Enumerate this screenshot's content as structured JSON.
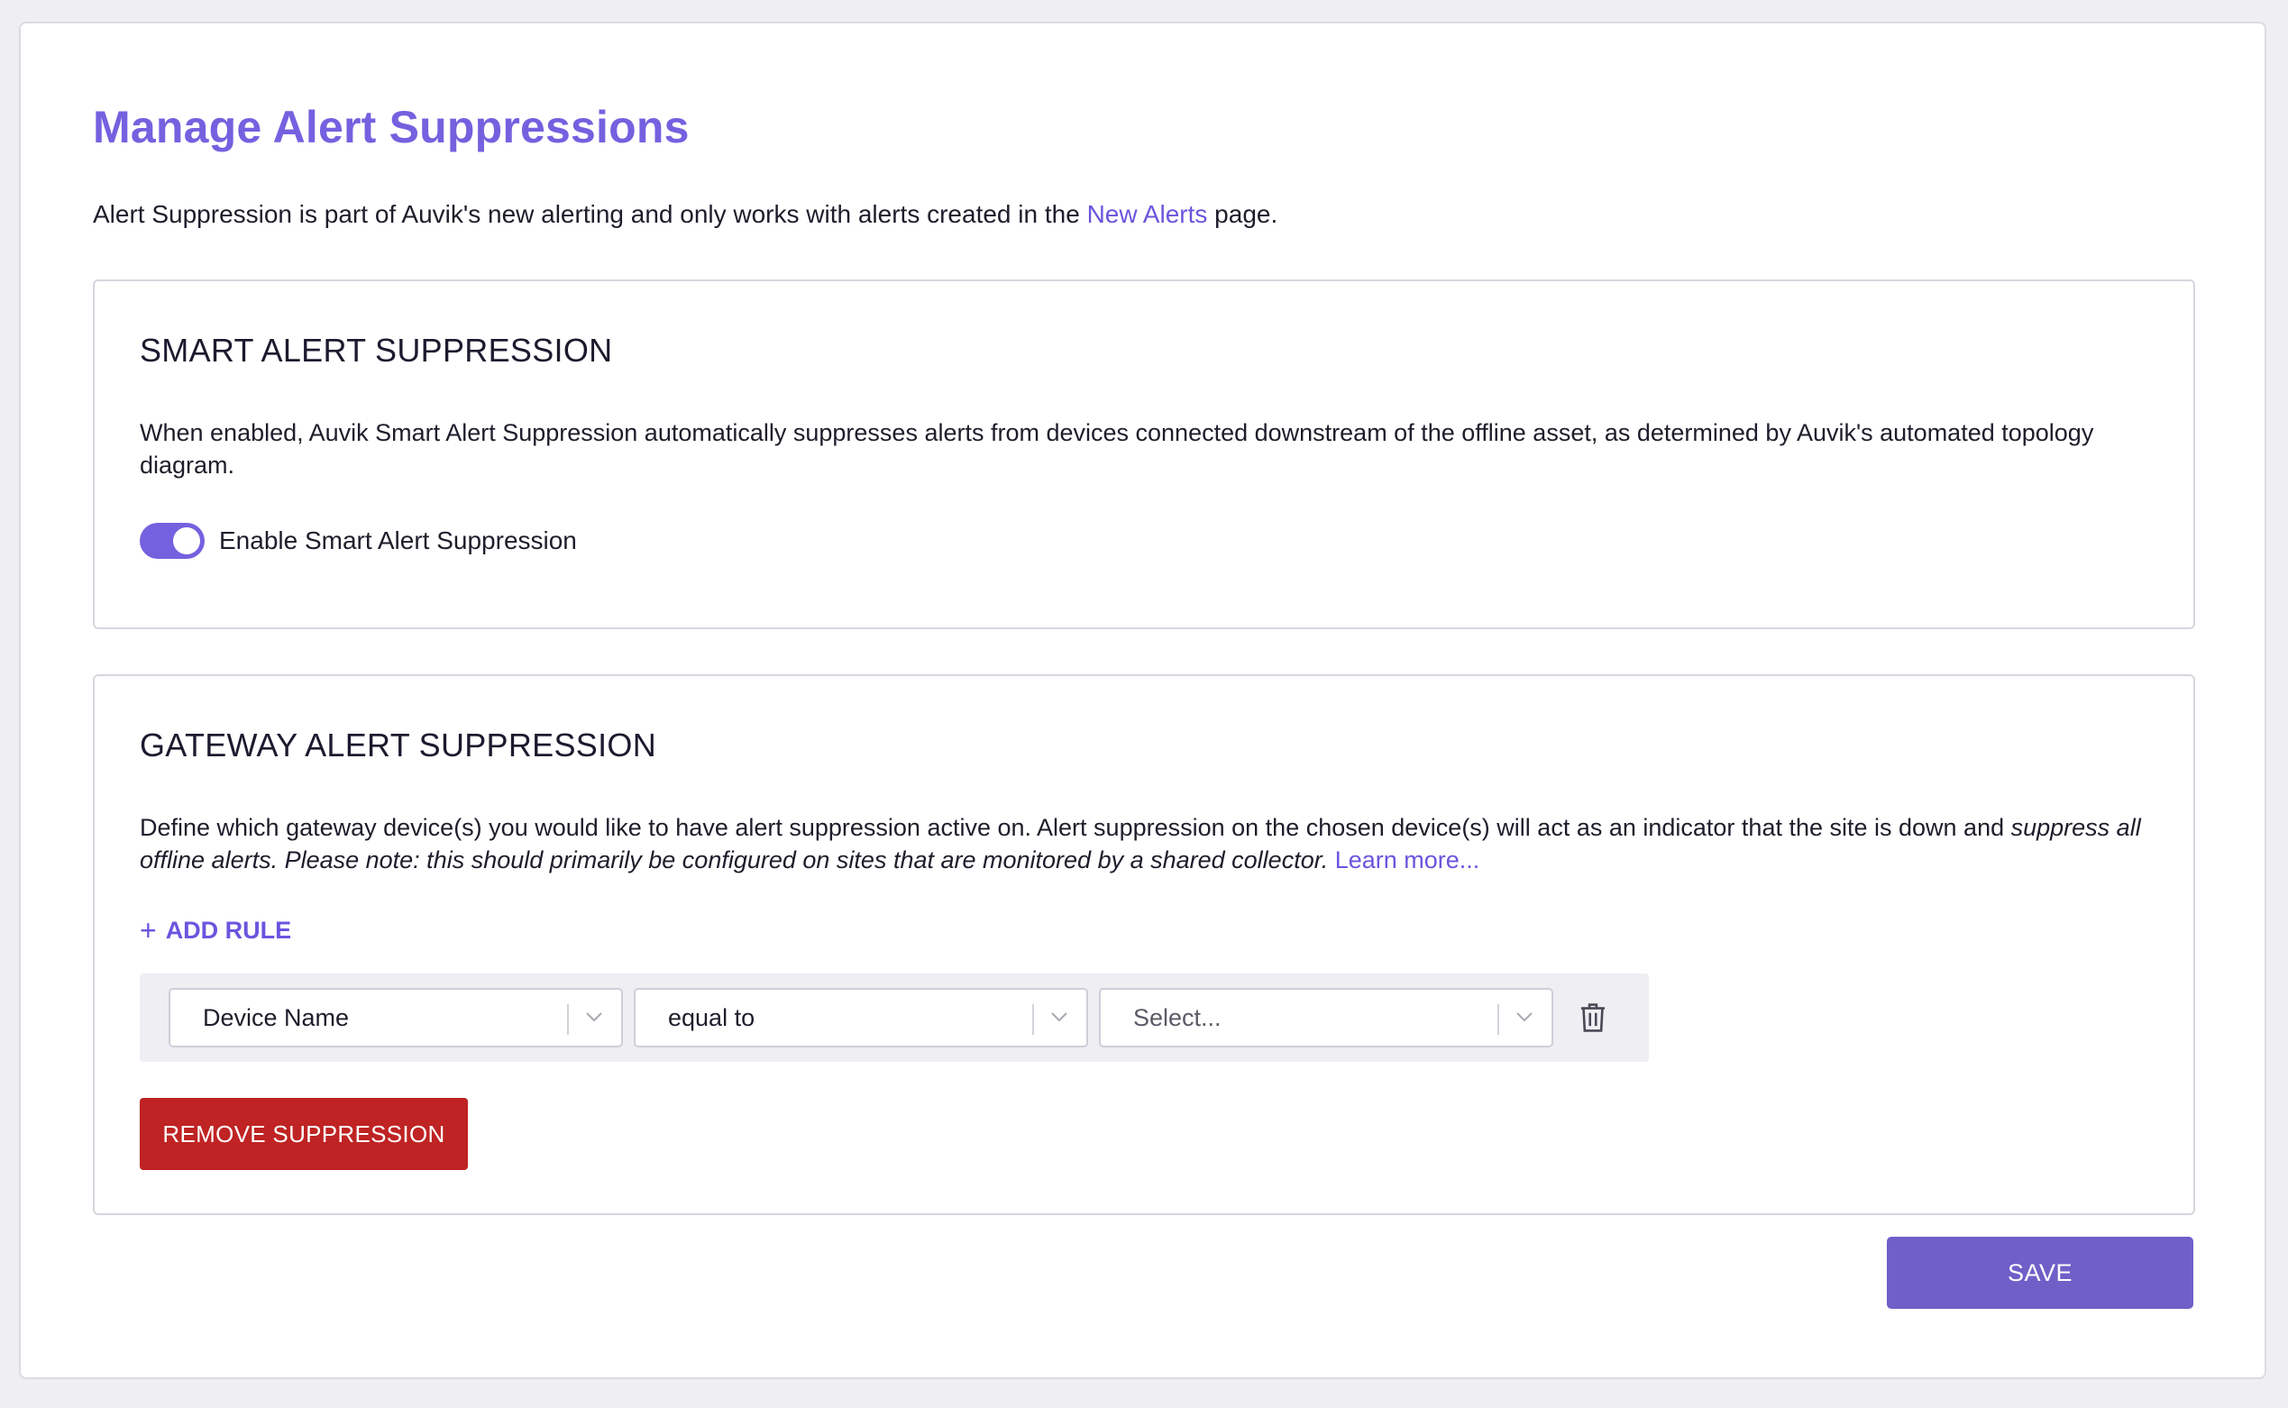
{
  "page": {
    "title": "Manage Alert Suppressions",
    "intro_before": "Alert Suppression is part of Auvik's new alerting and only works with alerts created in the ",
    "intro_link": "New Alerts",
    "intro_after": " page."
  },
  "smart": {
    "title": "SMART ALERT SUPPRESSION",
    "description": "When enabled, Auvik Smart Alert Suppression automatically suppresses alerts from devices connected downstream of the offline asset, as determined by Auvik's automated topology diagram.",
    "toggle_label": "Enable Smart Alert Suppression",
    "toggle_on": true
  },
  "gateway": {
    "title": "GATEWAY ALERT SUPPRESSION",
    "description_plain": "Define which gateway device(s) you would like to have alert suppression active on. Alert suppression on the chosen device(s) will act as an indicator that the site is down and ",
    "description_italic": "suppress all offline alerts. Please note: this should primarily be configured on sites that are monitored by a shared collector.",
    "learn_more": "Learn more...",
    "add_rule_label": "ADD RULE",
    "rule": {
      "field": "Device Name",
      "operator": "equal to",
      "value_placeholder": "Select..."
    },
    "remove_label": "REMOVE SUPPRESSION"
  },
  "footer": {
    "save_label": "SAVE"
  },
  "colors": {
    "accent": "#7461df",
    "danger": "#bf2323",
    "save": "#6f5fc7"
  }
}
